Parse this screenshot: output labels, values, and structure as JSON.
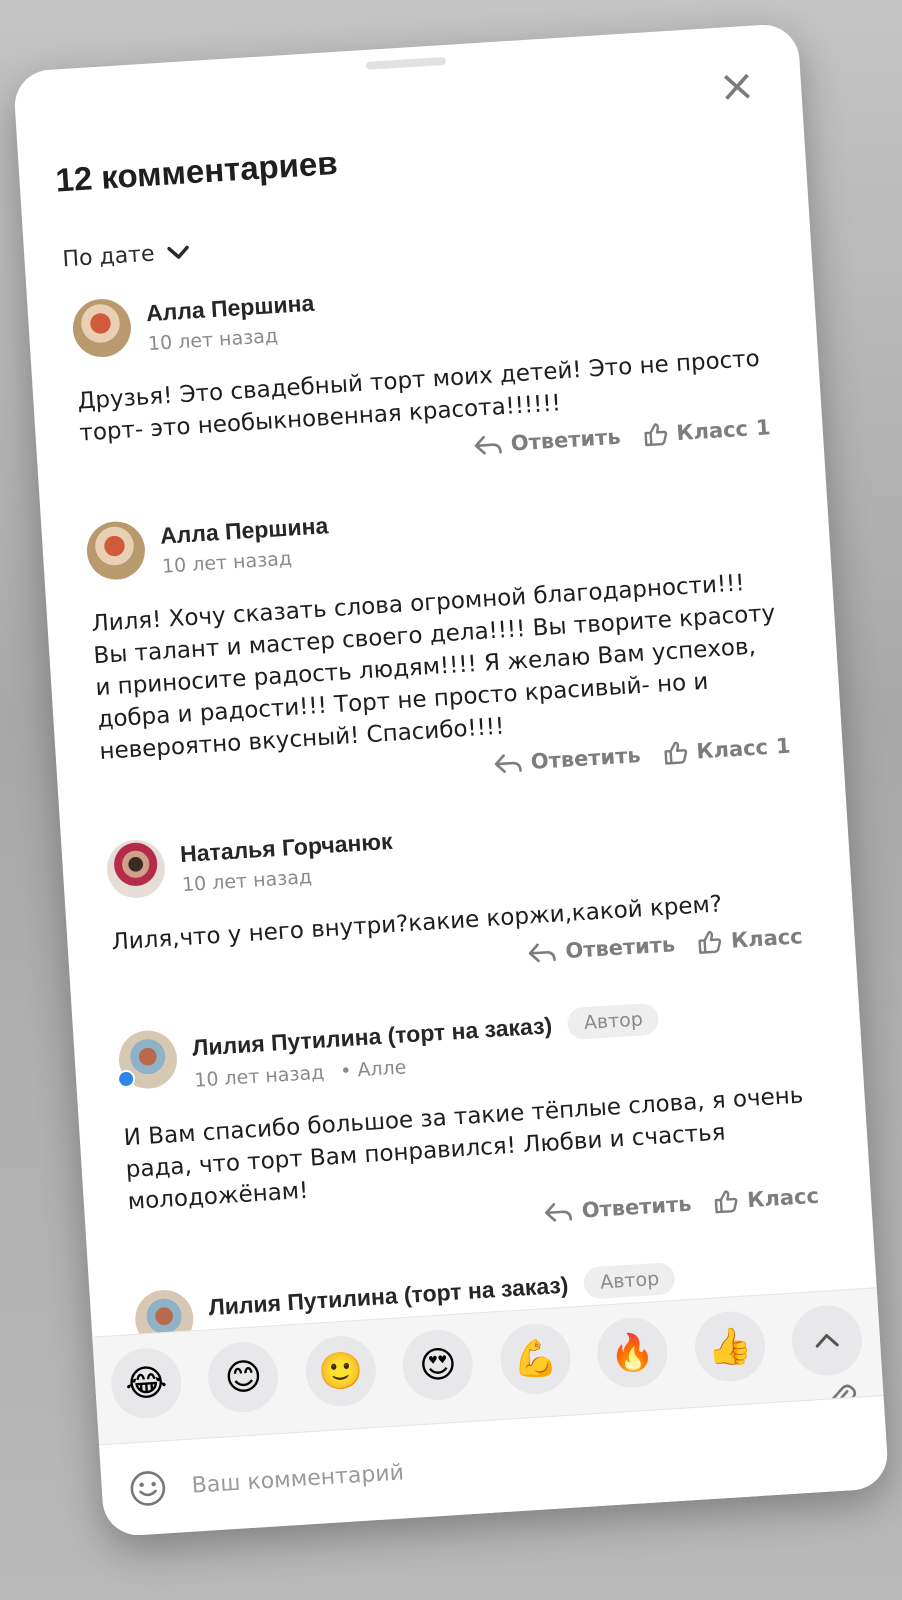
{
  "header": {
    "title": "12 комментариев",
    "close_icon": "×",
    "sort_label": "По дате"
  },
  "actions": {
    "reply_label": "Ответить",
    "like_label": "Класс"
  },
  "comments": [
    {
      "author": "Алла Першина",
      "time": "10 лет назад",
      "text": "Друзья! Это свадебный торт моих детей! Это не просто торт- это необыкновенная красота!!!!!!",
      "likes": "1"
    },
    {
      "author": "Алла Першина",
      "time": "10 лет назад",
      "text": "Лиля! Хочу сказать слова огромной благодарности!!! Вы талант и мастер своего дела!!!! Вы творите красоту и приносите радость людям!!!! Я желаю Вам  успехов, добра и радости!!! Торт не просто красивый- но и невероятно вкусный! Спасибо!!!!",
      "likes": "1"
    },
    {
      "author": "Наталья Горчанюк",
      "time": "10 лет назад",
      "text": "Лиля,что у него внутри?какие коржи,какой крем?"
    },
    {
      "author": "Лилия Путилина (торт на заказ)",
      "badge": "Автор",
      "time": "10 лет назад",
      "reply_to": "• Алле",
      "text": "И Вам спасибо большое за такие тёплые слова, я очень рада, что торт Вам понравился! Любви и счастья молодожёнам!"
    },
    {
      "author": "Лилия Путилина (торт на заказ)",
      "badge": "Автор"
    }
  ],
  "reactions": [
    "😂",
    "😊",
    "🙂",
    "😍",
    "💪",
    "🔥",
    "👍"
  ],
  "scroll_up_icon": "⌃",
  "composer": {
    "placeholder": "Ваш комментарий"
  },
  "icons": [
    "close-icon",
    "chevron-down-icon",
    "reply-arrow-icon",
    "thumbs-up-icon",
    "chevron-up-icon",
    "paperclip-icon",
    "smile-icon"
  ],
  "colors": {
    "accent_dot": "#2b87ea",
    "muted": "#8a8a8a",
    "sheet": "#ffffff"
  }
}
